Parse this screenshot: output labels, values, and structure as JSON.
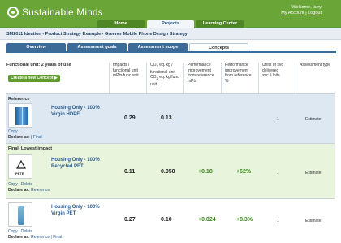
{
  "brand": "Sustainable Minds",
  "user": {
    "welcome": "Welcome, larry",
    "account": "My Account",
    "logout": "Logout",
    "sep": "|"
  },
  "nav": {
    "tabs": [
      "Home",
      "Projects",
      "Learning Center"
    ],
    "active": 1
  },
  "strategy_title": "SM2011 Ideation - Product Strategy Example - Greener Mobile Phone Design Strategy",
  "subtabs": {
    "labels": [
      "Overview",
      "Assessment goals",
      "Assessment scope",
      "Concepts"
    ],
    "active": 3
  },
  "table": {
    "functional_unit": "Functional unit: 2 years of use",
    "create_button": "Create a new Concept",
    "columns": {
      "impacts": [
        "Impacts /",
        "functional unit",
        "mPts/func unit"
      ],
      "co2": [
        "CO",
        "2",
        " eq. kg /",
        "functional unit",
        "CO",
        "2",
        " eq. kg/func",
        "unit"
      ],
      "perf_mpts": [
        "Performance",
        "improvement",
        "from reference",
        "mPts"
      ],
      "perf_pct": [
        "Performance",
        "improvement",
        "from reference",
        "%"
      ],
      "units": [
        "Units of svc",
        "delivered",
        "svc. Units"
      ],
      "assess": "Assessment type"
    },
    "rows": [
      {
        "label": "Reference",
        "name": "Housing Only - 100% Virgin HDPE",
        "impacts": "0.29",
        "co2": "0.13",
        "perf_mpts": "",
        "perf_pct": "",
        "units": "1",
        "assessment": "Estimate",
        "actions": [
          "Copy"
        ],
        "declare_label": "Declare as:",
        "declare_options": [
          "Final"
        ],
        "thumb": "building-icon"
      },
      {
        "label": "Final, Lowest impact",
        "name": "Housing Only - 100% Recycled PET",
        "impacts": "0.11",
        "co2": "0.050",
        "perf_mpts": "+0.18",
        "perf_pct": "+62%",
        "units": "1",
        "assessment": "Estimate",
        "actions": [
          "Copy",
          "Delete"
        ],
        "declare_label": "Declare as:",
        "declare_options": [
          "Reference"
        ],
        "thumb": "recycle-pete-icon",
        "thumb_label": "PETE"
      },
      {
        "label": "",
        "name": "Housing Only - 100% Virgin PET",
        "impacts": "0.27",
        "co2": "0.10",
        "perf_mpts": "+0.024",
        "perf_pct": "+8.3%",
        "units": "1",
        "assessment": "Estimate",
        "actions": [
          "Copy",
          "Delete"
        ],
        "declare_label": "Declare as:",
        "declare_options": [
          "Reference",
          "Final"
        ],
        "thumb": "bottle-icon"
      }
    ]
  },
  "colors": {
    "header_green": "#6aa637",
    "nav_blue": "#3d6b97",
    "link_blue": "#2d5c8a",
    "positive_green": "#3d8a1e"
  }
}
